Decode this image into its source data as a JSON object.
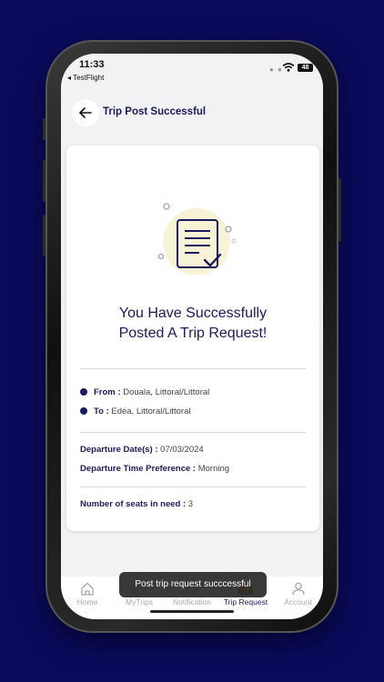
{
  "status_bar": {
    "time": "11:33",
    "back_app": "◂ TestFlight",
    "battery": "48"
  },
  "header": {
    "title": "Trip Post Successful"
  },
  "success": {
    "line1": "You Have Successfully",
    "line2": "Posted A Trip Request!"
  },
  "trip": {
    "from_label": "From :",
    "from_value": " Douala, Littoral/Littoral",
    "to_label": "To :",
    "to_value": " Edéa, Littoral/Littoral",
    "date_label": "Departure Date(s) :",
    "date_value": " 07/03/2024",
    "time_label": "Departure Time Preference :",
    "time_value": " Morning",
    "seats_label": "Number of seats in need :",
    "seats_value": " 3"
  },
  "tabs": [
    {
      "label": "Home",
      "icon": "home-icon"
    },
    {
      "label": "MyTrips",
      "icon": "car-icon"
    },
    {
      "label": "Notification",
      "icon": "bell-icon"
    },
    {
      "label": "Trip Request",
      "icon": "taxi-icon"
    },
    {
      "label": "Account",
      "icon": "user-icon"
    }
  ],
  "toast": {
    "text": "Post trip request succcessful"
  },
  "colors": {
    "background": "#0a0a5c",
    "accent": "#1b1b5c",
    "illustration_bg": "#f7f3d6"
  }
}
